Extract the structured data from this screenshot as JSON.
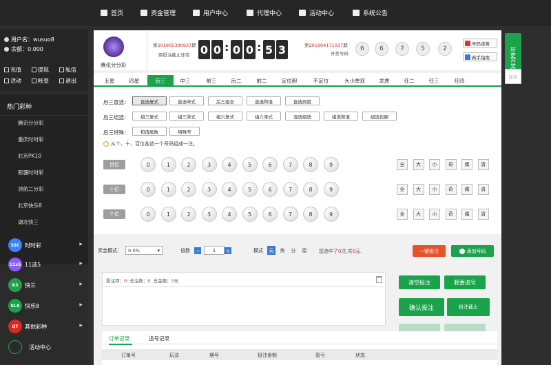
{
  "nav": [
    {
      "label": "首页",
      "icon": "home-icon"
    },
    {
      "label": "资金管理",
      "icon": "wallet-icon"
    },
    {
      "label": "用户中心",
      "icon": "user-icon"
    },
    {
      "label": "代理中心",
      "icon": "diamond-icon"
    },
    {
      "label": "活动中心",
      "icon": "cup-icon"
    },
    {
      "label": "系统公告",
      "icon": "bell-icon"
    }
  ],
  "user": {
    "name_label": "用户名：wusuo8",
    "balance_label": "余额：0.000"
  },
  "actions": [
    "充值",
    "提现",
    "私信",
    "活动",
    "帐变",
    "退出"
  ],
  "hot": {
    "title": "热门彩种",
    "games": [
      "腾讯分分彩",
      "重庆时时彩",
      "北京PK10",
      "新疆时时彩",
      "领航二分彩",
      "北京快乐8",
      "湖北快三"
    ]
  },
  "categories": [
    {
      "name": "时时彩",
      "badge": "SSC",
      "color": "#3b82f6"
    },
    {
      "name": "11选5",
      "badge": "11x5",
      "color": "#8b5cf6"
    },
    {
      "name": "快三",
      "badge": "K3",
      "color": "#22a04b"
    },
    {
      "name": "快乐8",
      "badge": "KL8",
      "color": "#16a34a"
    },
    {
      "name": "其他彩种",
      "badge": "QT",
      "color": "#dc2626"
    },
    {
      "name": "活动中心",
      "badge": "",
      "color": "#2b2b2b"
    }
  ],
  "header": {
    "game_name": "腾讯分分彩",
    "current_issue_prefix": "第",
    "current_issue": "201905300937",
    "current_issue_suffix": "期",
    "deadline_label": "距投注截止还有",
    "timer": [
      "0",
      "0",
      "0",
      "0",
      "5",
      "3"
    ],
    "last_issue_prefix": "第",
    "last_issue": "201904171037",
    "last_issue_suffix": "期",
    "draw_label": "开奖号码",
    "draw_numbers": [
      "6",
      "6",
      "7",
      "5",
      "2"
    ],
    "trend_btn": "号码走势",
    "guide_btn": "新手指南"
  },
  "tabs": [
    "五星",
    "四星",
    "后三",
    "中三",
    "前三",
    "后二",
    "前二",
    "定位胆",
    "不定位",
    "大小单双",
    "龙虎",
    "任二",
    "任三",
    "任四"
  ],
  "active_tab": "后三",
  "rows": [
    {
      "label": "后三直选：",
      "items": [
        "直选复式",
        "直选单式",
        "后三组合",
        "直选和值",
        "直选跨度"
      ]
    },
    {
      "label": "后三组选：",
      "items": [
        "组三复式",
        "组三单式",
        "组六复式",
        "组六单式",
        "混选组选",
        "组选和值",
        "组选包胆"
      ]
    },
    {
      "label": "后三特殊：",
      "items": [
        "和值尾数",
        "特殊号"
      ]
    }
  ],
  "hint": "从个、十、百位各选一个号码组成一注。",
  "positions": [
    "百位",
    "十位",
    "个位"
  ],
  "numbers": [
    "0",
    "1",
    "2",
    "3",
    "4",
    "5",
    "6",
    "7",
    "8",
    "9"
  ],
  "filters": [
    "全",
    "大",
    "小",
    "奇",
    "偶",
    "清"
  ],
  "bet": {
    "prize_label": "奖金模式：",
    "prize_value": "0-0%",
    "multiple_label": "倍数",
    "multiple_value": "1",
    "minus": "−",
    "plus": "+",
    "mode_label": "模式",
    "modes": [
      "元",
      "角",
      "分",
      "厘"
    ],
    "sum_a": "您选中了",
    "sum_bets": "0",
    "sum_b": "注,共",
    "sum_amount": "0",
    "sum_c": "元.",
    "quick_btn": "一键投注",
    "add_btn": "添加号码"
  },
  "cart": {
    "l1": "投注项：",
    "v1": "0",
    "l2": "总注数：",
    "v2": "0",
    "l3": "总金额：",
    "v3": "0",
    "unit": "元"
  },
  "side_buttons": {
    "clear": "清空投注",
    "chase": "我要追号",
    "confirm": "确认投注",
    "deadline": "投注截止"
  },
  "records": {
    "tabs": [
      "订单记录",
      "追号记录"
    ],
    "headers": [
      "订单号",
      "玩法",
      "期号",
      "投注金额",
      "盈亏",
      "状态"
    ]
  },
  "right_bar": {
    "history": "历史开奖",
    "show": "显示"
  }
}
